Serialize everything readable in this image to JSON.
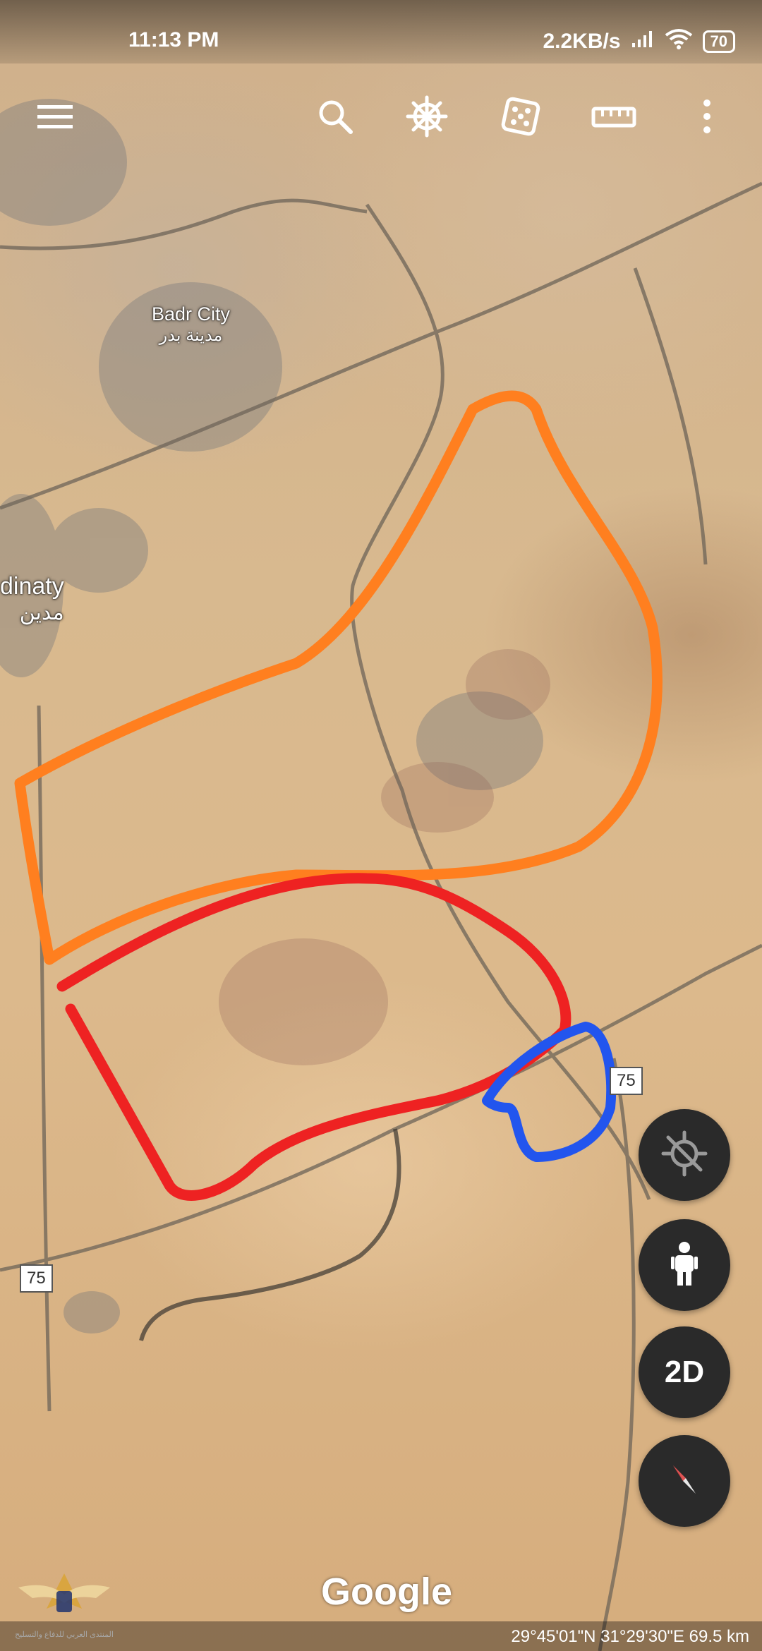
{
  "status_bar": {
    "time": "11:13 PM",
    "network_speed": "2.2KB/s",
    "battery": "70"
  },
  "toolbar": {
    "icons": [
      "menu-icon",
      "search-icon",
      "voyager-wheel-icon",
      "feeling-lucky-dice-icon",
      "measure-ruler-icon",
      "more-vert-icon"
    ]
  },
  "map": {
    "labels": {
      "badr_city_en": "Badr City",
      "badr_city_ar": "مدينة بدر",
      "madinaty_en": "dinaty",
      "madinaty_ar": "مدين"
    },
    "road_shields": [
      "75",
      "75"
    ],
    "annotation_colors": {
      "orange": "#ff7f1f",
      "red": "#ee2222",
      "blue": "#2255ee"
    }
  },
  "fabs": {
    "location_icon": "location-disabled-icon",
    "streetview_icon": "pegman-icon",
    "mode_label": "2D",
    "compass_icon": "compass-icon"
  },
  "attribution": {
    "logo": "Google",
    "coordinates": "29°45'01\"N 31°29'30\"E 69.5 km"
  },
  "watermark": {
    "text": "المنتدى العربي للدفاع والتسليح"
  }
}
